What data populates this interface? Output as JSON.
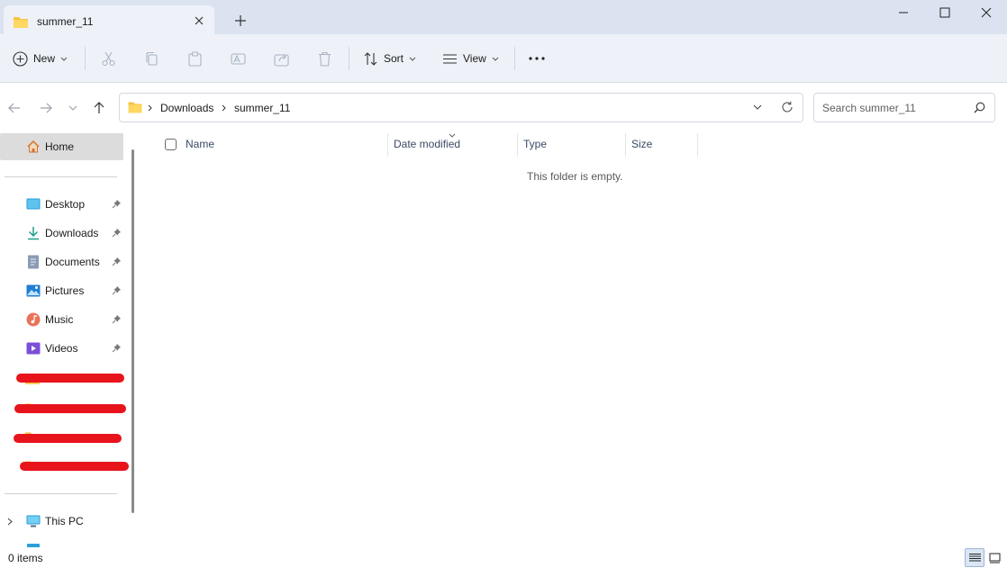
{
  "window": {
    "tab_title": "summer_11"
  },
  "toolbar": {
    "new_label": "New",
    "sort_label": "Sort",
    "view_label": "View"
  },
  "address": {
    "crumbs": [
      "Downloads",
      "summer_11"
    ],
    "search_placeholder": "Search summer_11"
  },
  "sidebar": {
    "home": "Home",
    "quick_access": [
      {
        "label": "Desktop",
        "icon": "desktop-icon"
      },
      {
        "label": "Downloads",
        "icon": "download-icon"
      },
      {
        "label": "Documents",
        "icon": "documents-icon"
      },
      {
        "label": "Pictures",
        "icon": "pictures-icon"
      },
      {
        "label": "Music",
        "icon": "music-icon"
      },
      {
        "label": "Videos",
        "icon": "videos-icon"
      }
    ],
    "this_pc": "This PC"
  },
  "columns": [
    "Name",
    "Date modified",
    "Type",
    "Size"
  ],
  "content": {
    "empty_message": "This folder is empty."
  },
  "status": {
    "item_count": "0 items"
  },
  "colors": {
    "titlebar": "#dbe3f0",
    "commandbar": "#eef2f8",
    "folder": "#f6c343",
    "redaction": "#e8141c"
  }
}
